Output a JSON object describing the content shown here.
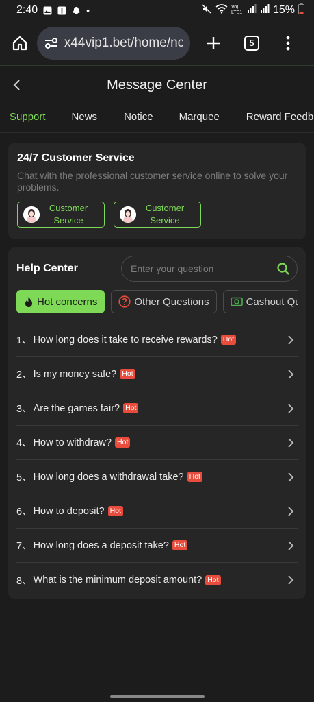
{
  "status_bar": {
    "time": "2:40",
    "battery": "15%",
    "net_label": "Vo) LTE1"
  },
  "browser": {
    "url": "x44vip1.bet/home/nc",
    "tab_count": "5"
  },
  "header": {
    "title": "Message Center"
  },
  "tabs": [
    {
      "label": "Support",
      "active": true
    },
    {
      "label": "News"
    },
    {
      "label": "Notice"
    },
    {
      "label": "Marquee"
    },
    {
      "label": "Reward Feedb"
    }
  ],
  "customer_service": {
    "title": "24/7 Customer Service",
    "description": "Chat with the professional customer service online to solve your problems.",
    "buttons": [
      {
        "label": "Customer Service"
      },
      {
        "label": "Customer Service"
      }
    ]
  },
  "help_center": {
    "title": "Help Center",
    "search_placeholder": "Enter your question",
    "categories": [
      {
        "label": "Hot concerns",
        "icon": "flame-icon",
        "active": true
      },
      {
        "label": "Other Questions",
        "icon": "question-icon"
      },
      {
        "label": "Cashout Qu",
        "icon": "cash-icon"
      }
    ],
    "hot_label": "Hot",
    "faqs": [
      {
        "num": "1、",
        "q": "How long does it take to receive rewards?"
      },
      {
        "num": "2、",
        "q": "Is my money safe?"
      },
      {
        "num": "3、",
        "q": "Are the games fair?"
      },
      {
        "num": "4、",
        "q": "How to withdraw?"
      },
      {
        "num": "5、",
        "q": "How long does a withdrawal take?"
      },
      {
        "num": "6、",
        "q": "How to deposit?"
      },
      {
        "num": "7、",
        "q": "How long does a deposit take?"
      },
      {
        "num": "8、",
        "q": "What is the minimum deposit amount?"
      }
    ]
  },
  "colors": {
    "accent": "#7ed957",
    "hot_badge": "#e74c3c",
    "card_bg": "#262626",
    "page_bg": "#1c1c1c"
  }
}
